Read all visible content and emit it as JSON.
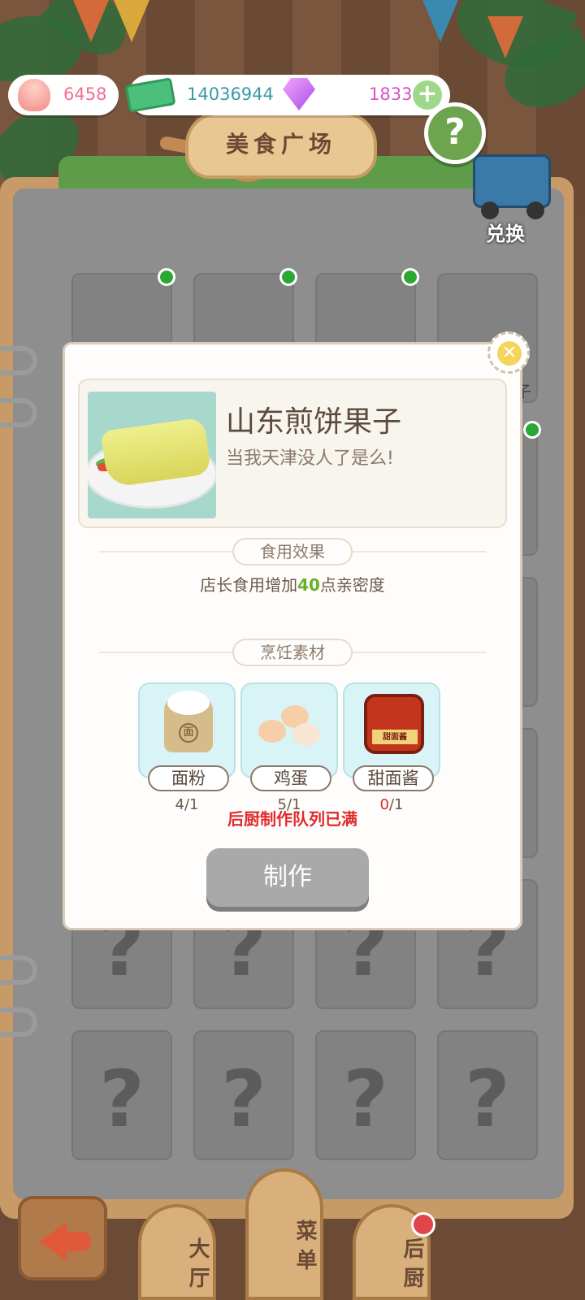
{
  "hud": {
    "shell_value": "6458",
    "cash_value": "14036944",
    "gem_value": "1833",
    "plus_symbol": "+",
    "help_symbol": "?"
  },
  "header": {
    "title": "美食广场",
    "exchange_label": "兑换"
  },
  "menu_grid": {
    "unknown_symbol": "?",
    "peek_label": "子"
  },
  "modal": {
    "close_symbol": "✕",
    "dish_name": "山东煎饼果子",
    "dish_desc": "当我天津没人了是么!",
    "effect_section": "食用效果",
    "effect_prefix": "店长食用增加",
    "effect_value": "40",
    "effect_suffix": "点亲密度",
    "ingredients_section": "烹饪素材",
    "ingredients": [
      {
        "name": "面粉",
        "have": "4",
        "need": "/1"
      },
      {
        "name": "鸡蛋",
        "have": "5",
        "need": "/1"
      },
      {
        "name": "甜面酱",
        "have": "0",
        "need": "/1"
      }
    ],
    "jar_text": "甜面酱",
    "flour_text": "面",
    "warning": "后厨制作队列已满",
    "make_button": "制作"
  },
  "bottom_nav": {
    "tabs": [
      "大厅",
      "菜单",
      "后厨"
    ]
  },
  "colors": {
    "accent_green": "#6ab02a",
    "warning_red": "#e02a2a",
    "disabled_button": "#a9a9a9"
  }
}
